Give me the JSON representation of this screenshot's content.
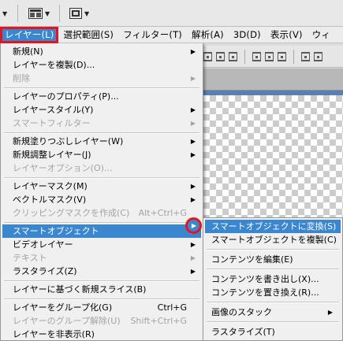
{
  "toolbar": {
    "icons": [
      "dropdown-arrow",
      "arrange-documents-icon",
      "screen-mode-icon"
    ]
  },
  "menubar": {
    "items": [
      {
        "label": "レイヤー(L)",
        "active": true
      },
      {
        "label": "選択範囲(S)"
      },
      {
        "label": "フィルター(T)"
      },
      {
        "label": "解析(A)"
      },
      {
        "label": "3D(D)"
      },
      {
        "label": "表示(V)"
      },
      {
        "label": "ウィ"
      }
    ]
  },
  "layer_menu": {
    "items": [
      {
        "label": "新規(N)",
        "submenu": true
      },
      {
        "label": "レイヤーを複製(D)..."
      },
      {
        "label": "削除",
        "submenu": true,
        "disabled": true
      },
      {
        "label": "レイヤーのプロパティ(P)..."
      },
      {
        "label": "レイヤースタイル(Y)",
        "submenu": true
      },
      {
        "label": "スマートフィルター",
        "submenu": true,
        "disabled": true
      },
      {
        "label": "新規塗りつぶしレイヤー(W)",
        "submenu": true
      },
      {
        "label": "新規調整レイヤー(J)",
        "submenu": true
      },
      {
        "label": "レイヤーオプション(O)...",
        "disabled": true
      },
      {
        "label": "レイヤーマスク(M)",
        "submenu": true
      },
      {
        "label": "ベクトルマスク(V)",
        "submenu": true
      },
      {
        "label": "クリッピングマスクを作成(C)",
        "shortcut": "Alt+Ctrl+G",
        "disabled": true
      },
      {
        "label": "スマートオブジェクト",
        "submenu": true,
        "highlighted": true
      },
      {
        "label": "ビデオレイヤー",
        "submenu": true
      },
      {
        "label": "テキスト",
        "submenu": true,
        "disabled": true
      },
      {
        "label": "ラスタライズ(Z)",
        "submenu": true
      },
      {
        "label": "レイヤーに基づく新規スライス(B)"
      },
      {
        "label": "レイヤーをグループ化(G)",
        "shortcut": "Ctrl+G"
      },
      {
        "label": "レイヤーのグループ解除(U)",
        "shortcut": "Shift+Ctrl+G",
        "disabled": true
      },
      {
        "label": "レイヤーを非表示(R)"
      }
    ]
  },
  "smart_object_submenu": {
    "items": [
      {
        "label": "スマートオブジェクトに変換(S)",
        "highlighted": true
      },
      {
        "label": "スマートオブジェクトを複製(C)"
      },
      {
        "label": "コンテンツを編集(E)"
      },
      {
        "label": "コンテンツを書き出し(X)..."
      },
      {
        "label": "コンテンツを置き換え(R)..."
      },
      {
        "label": "画像のスタック",
        "submenu": true
      },
      {
        "label": "ラスタライズ(T)"
      }
    ]
  },
  "colors": {
    "highlight": "#3a86cf",
    "annotation_red": "#e8141c",
    "disabled_text": "#a3a3a3"
  }
}
